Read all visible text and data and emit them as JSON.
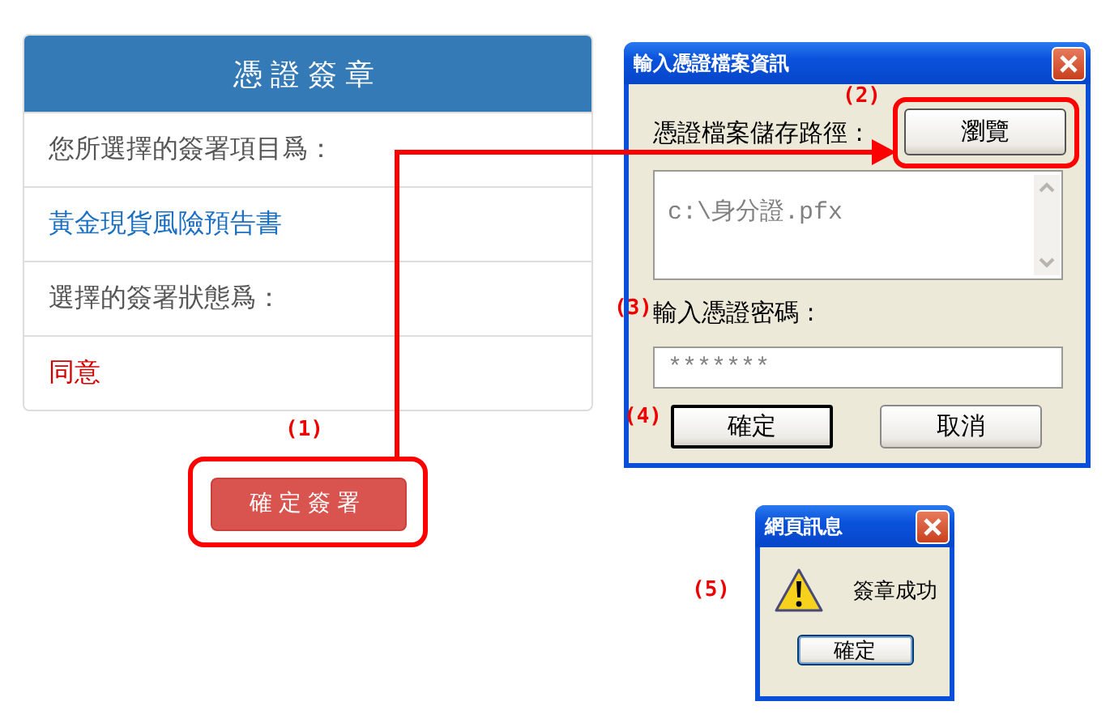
{
  "card": {
    "title": "憑證簽章",
    "rows": [
      {
        "kind": "label",
        "text": "您所選擇的簽署項目爲："
      },
      {
        "kind": "link",
        "text": "黃金現貨風險預告書"
      },
      {
        "kind": "label",
        "text": "選擇的簽署狀態爲："
      },
      {
        "kind": "status",
        "text": "同意"
      }
    ]
  },
  "sign_button": "確定簽署",
  "cert_dialog": {
    "title": "輸入憑證檔案資訊",
    "path_label": "憑證檔案儲存路徑 :",
    "browse_button": "瀏覽",
    "path_value": "c:\\身分證.pfx",
    "password_label": "輸入憑證密碼 :",
    "password_value": "*******",
    "buttons": [
      {
        "label": "確定",
        "default": true
      },
      {
        "label": "取消",
        "default": false
      }
    ]
  },
  "message_dialog": {
    "title": "網頁訊息",
    "message": "簽章成功",
    "button": "確定"
  },
  "annotations": [
    "(1)",
    "(2)",
    "(3)",
    "(4)",
    "(5)"
  ]
}
